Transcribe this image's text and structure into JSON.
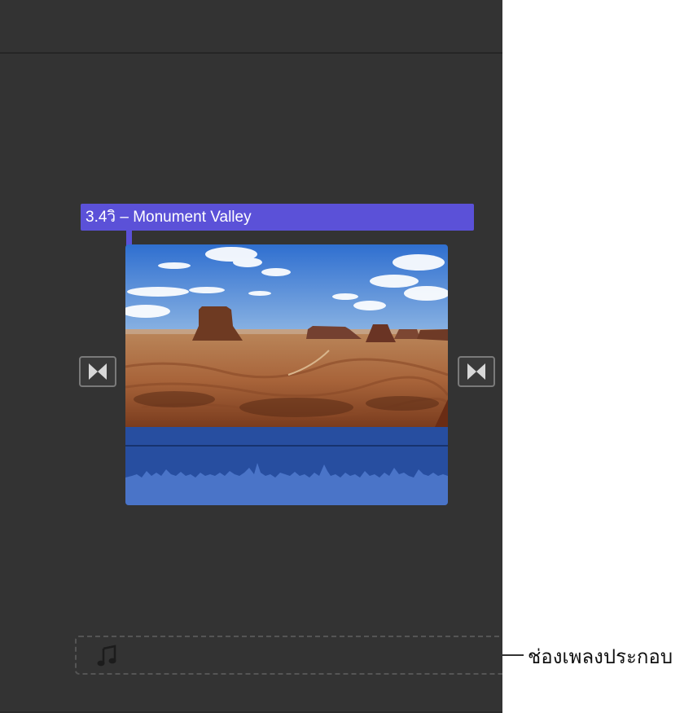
{
  "clip": {
    "title": "3.4วิ – Monument Valley"
  },
  "callout": {
    "music_well_label": "ช่องเพลงประกอบ"
  },
  "icons": {
    "transition_left": "transition-icon",
    "transition_right": "transition-icon",
    "music": "music-note-icon"
  },
  "colors": {
    "timeline_bg": "#333333",
    "title_bar": "#5b51d8",
    "audio_bg": "#274ea0",
    "waveform": "#4a74c8"
  }
}
